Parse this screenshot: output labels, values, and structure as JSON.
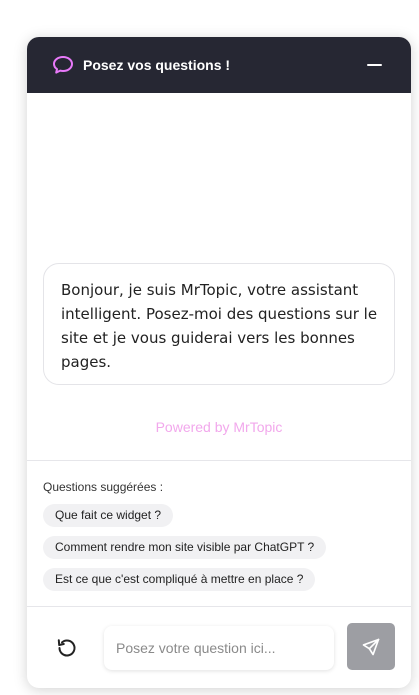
{
  "header": {
    "title": "Posez vos questions !",
    "icon": "chat-bubble-icon",
    "minimize_icon": "minus-icon"
  },
  "messages": [
    {
      "role": "assistant",
      "text": "Bonjour, je suis MrTopic, votre assistant intelligent. Posez-moi des questions sur le site et je vous guiderai vers les bonnes pages."
    }
  ],
  "powered_by": "Powered by MrTopic",
  "suggestions": {
    "label": "Questions suggérées :",
    "items": [
      "Que fait ce widget ?",
      "Comment rendre mon site visible par ChatGPT ?",
      "Est ce que c'est compliqué à mettre en place ?"
    ]
  },
  "composer": {
    "placeholder": "Posez votre question ici...",
    "value": "",
    "reset_icon": "refresh-icon",
    "send_icon": "send-icon"
  },
  "colors": {
    "header_bg": "#262733",
    "accent": "#e879f9",
    "powered_text": "#f2a8ec",
    "send_button": "#9d9ea3"
  }
}
